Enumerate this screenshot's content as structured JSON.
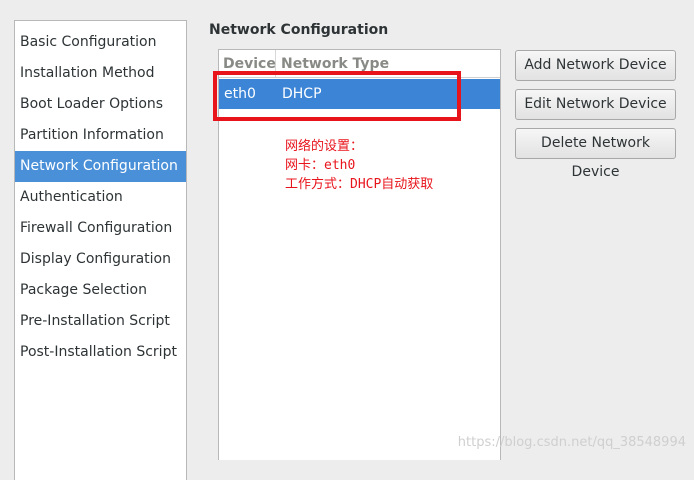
{
  "sidebar": {
    "items": [
      {
        "label": "Basic Configuration"
      },
      {
        "label": "Installation Method"
      },
      {
        "label": "Boot Loader Options"
      },
      {
        "label": "Partition Information"
      },
      {
        "label": "Network Configuration",
        "selected": true
      },
      {
        "label": "Authentication"
      },
      {
        "label": "Firewall Configuration"
      },
      {
        "label": "Display Configuration"
      },
      {
        "label": "Package Selection"
      },
      {
        "label": "Pre-Installation Script"
      },
      {
        "label": "Post-Installation Script"
      }
    ]
  },
  "main": {
    "title": "Network Configuration",
    "columns": {
      "device": "Device",
      "network_type": "Network Type"
    },
    "rows": [
      {
        "device": "eth0",
        "network_type": "DHCP"
      }
    ]
  },
  "annotation": {
    "line1": "网络的设置：",
    "line2": "网卡：eth0",
    "line3": "工作方式：DHCP自动获取"
  },
  "buttons": {
    "add": "Add Network Device",
    "edit": "Edit Network Device",
    "delete": "Delete Network Device"
  },
  "watermark": "https://blog.csdn.net/qq_38548994",
  "colors": {
    "selection": "#4a90d9",
    "annotation_red": "#e8141c"
  }
}
